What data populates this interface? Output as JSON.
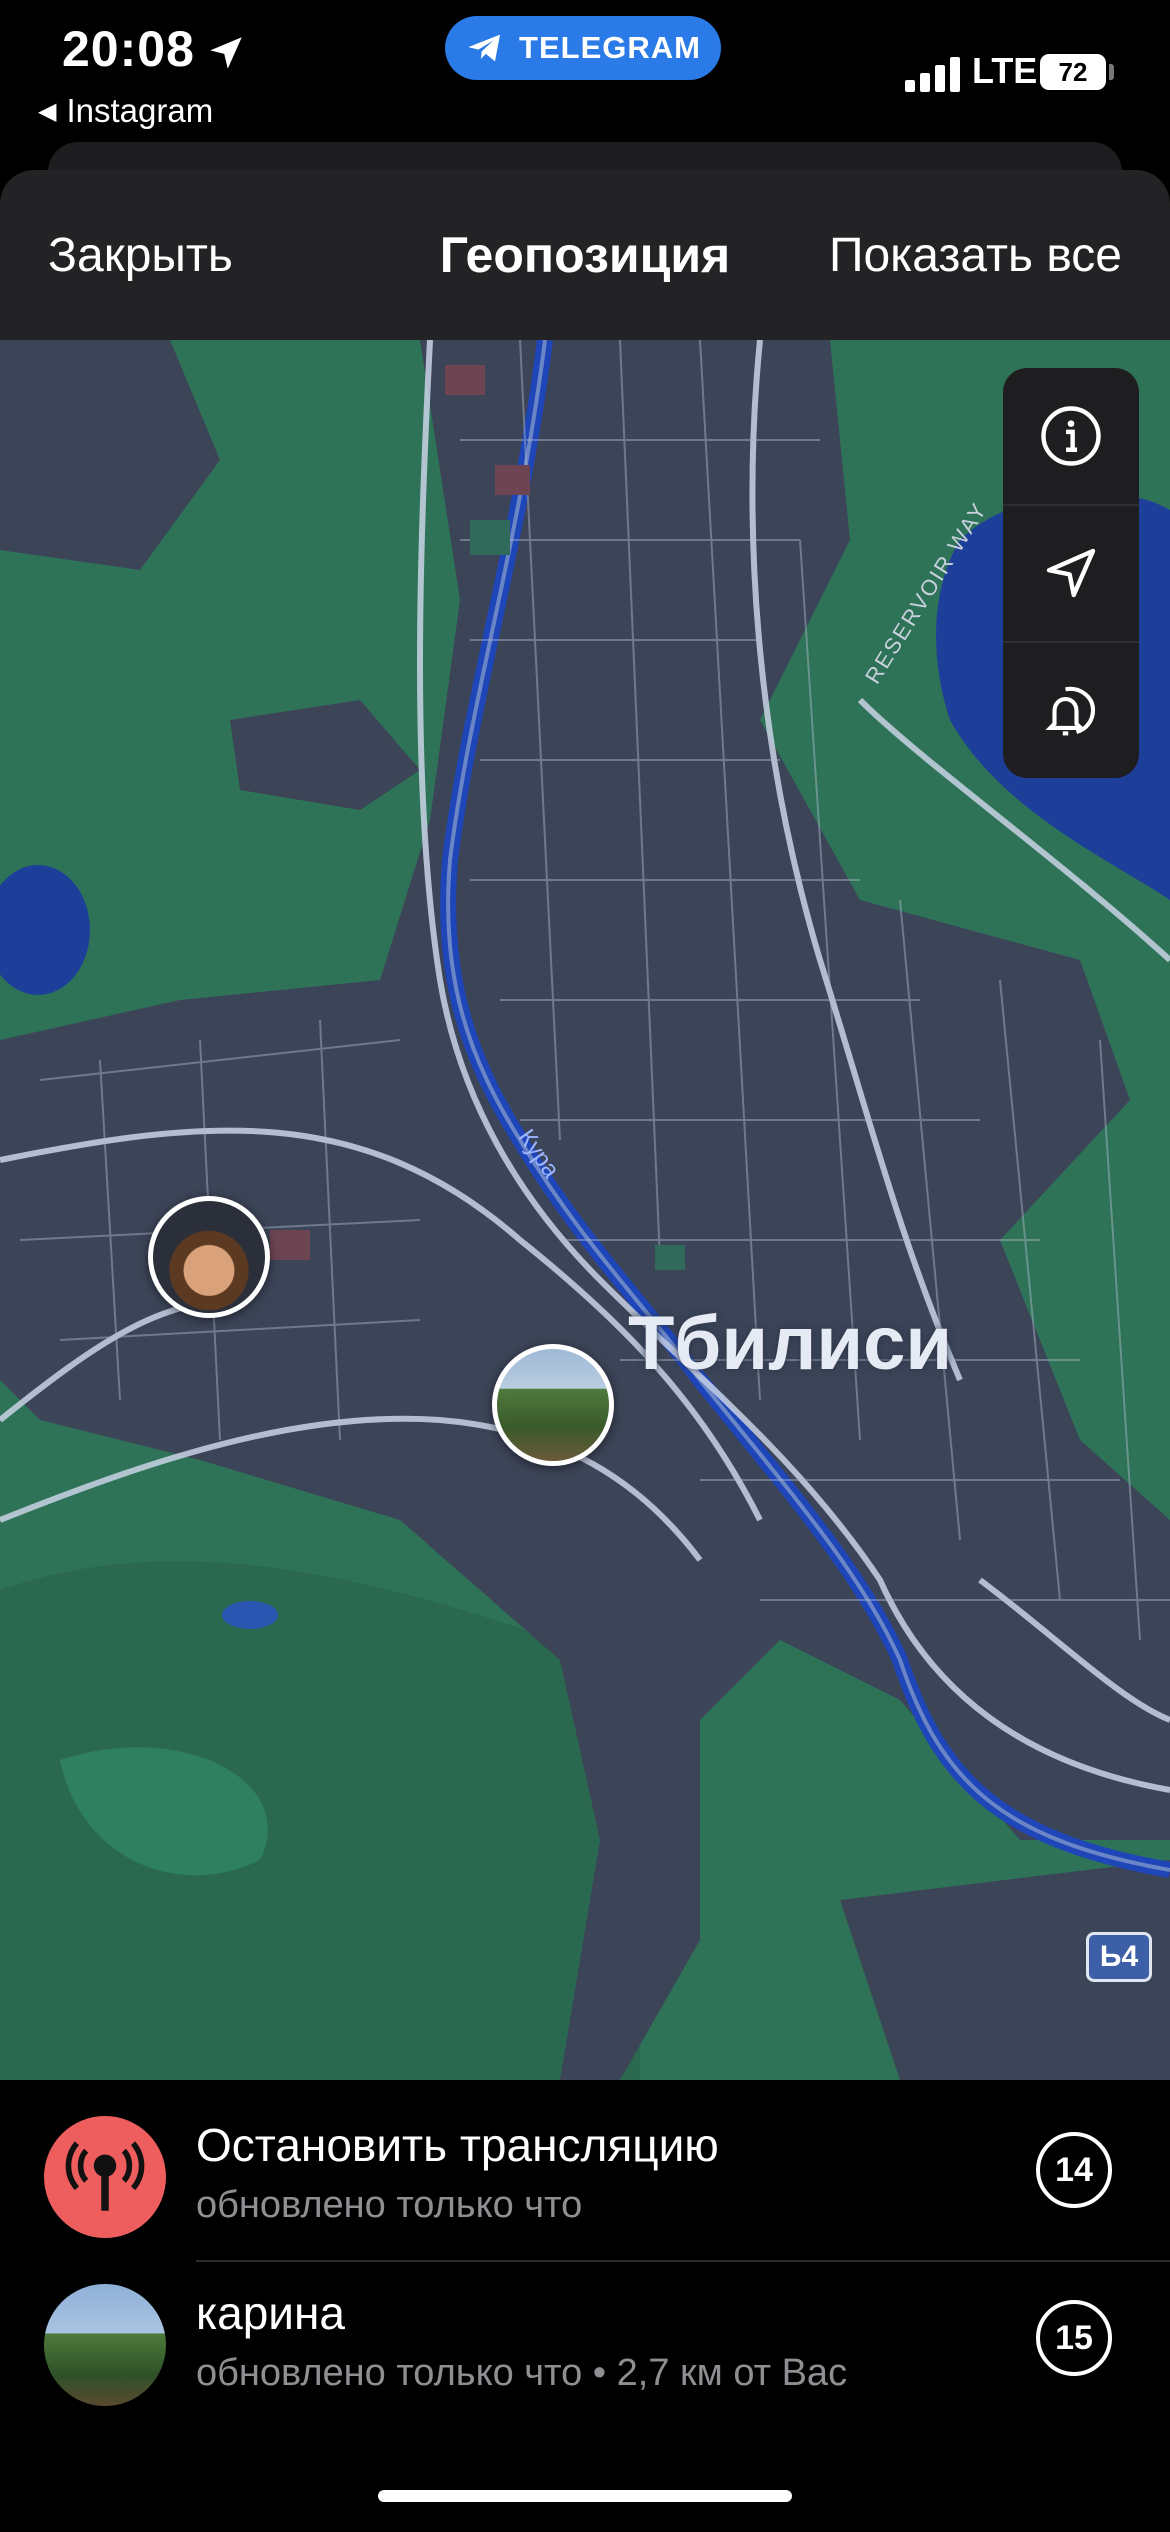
{
  "status_bar": {
    "time": "20:08",
    "back_app": "Instagram",
    "pill_label": "TELEGRAM",
    "network": "LTE",
    "battery": "72"
  },
  "header": {
    "close_label": "Закрыть",
    "title": "Геопозиция",
    "show_all_label": "Показать все"
  },
  "map": {
    "city_label": "Тбилиси",
    "river_label": "Кура",
    "road_label": "RESERVOIR WAY",
    "road_shield": "Ь4",
    "controls": [
      "info-icon",
      "location-arrow-icon",
      "notify-proximity-icon"
    ]
  },
  "list": {
    "stop": {
      "title": "Остановить трансляцию",
      "subtitle": "обновлено только что",
      "timer": "14"
    },
    "karina": {
      "name": "карина",
      "subtitle": "обновлено только что • 2,7 км от Вас",
      "timer": "15"
    }
  },
  "colors": {
    "accent_pill": "#2a7ae8",
    "stop_red": "#ef5e5e",
    "map_green": "#2e7358",
    "map_urban": "#3c4458",
    "water": "#1d3f9a"
  }
}
